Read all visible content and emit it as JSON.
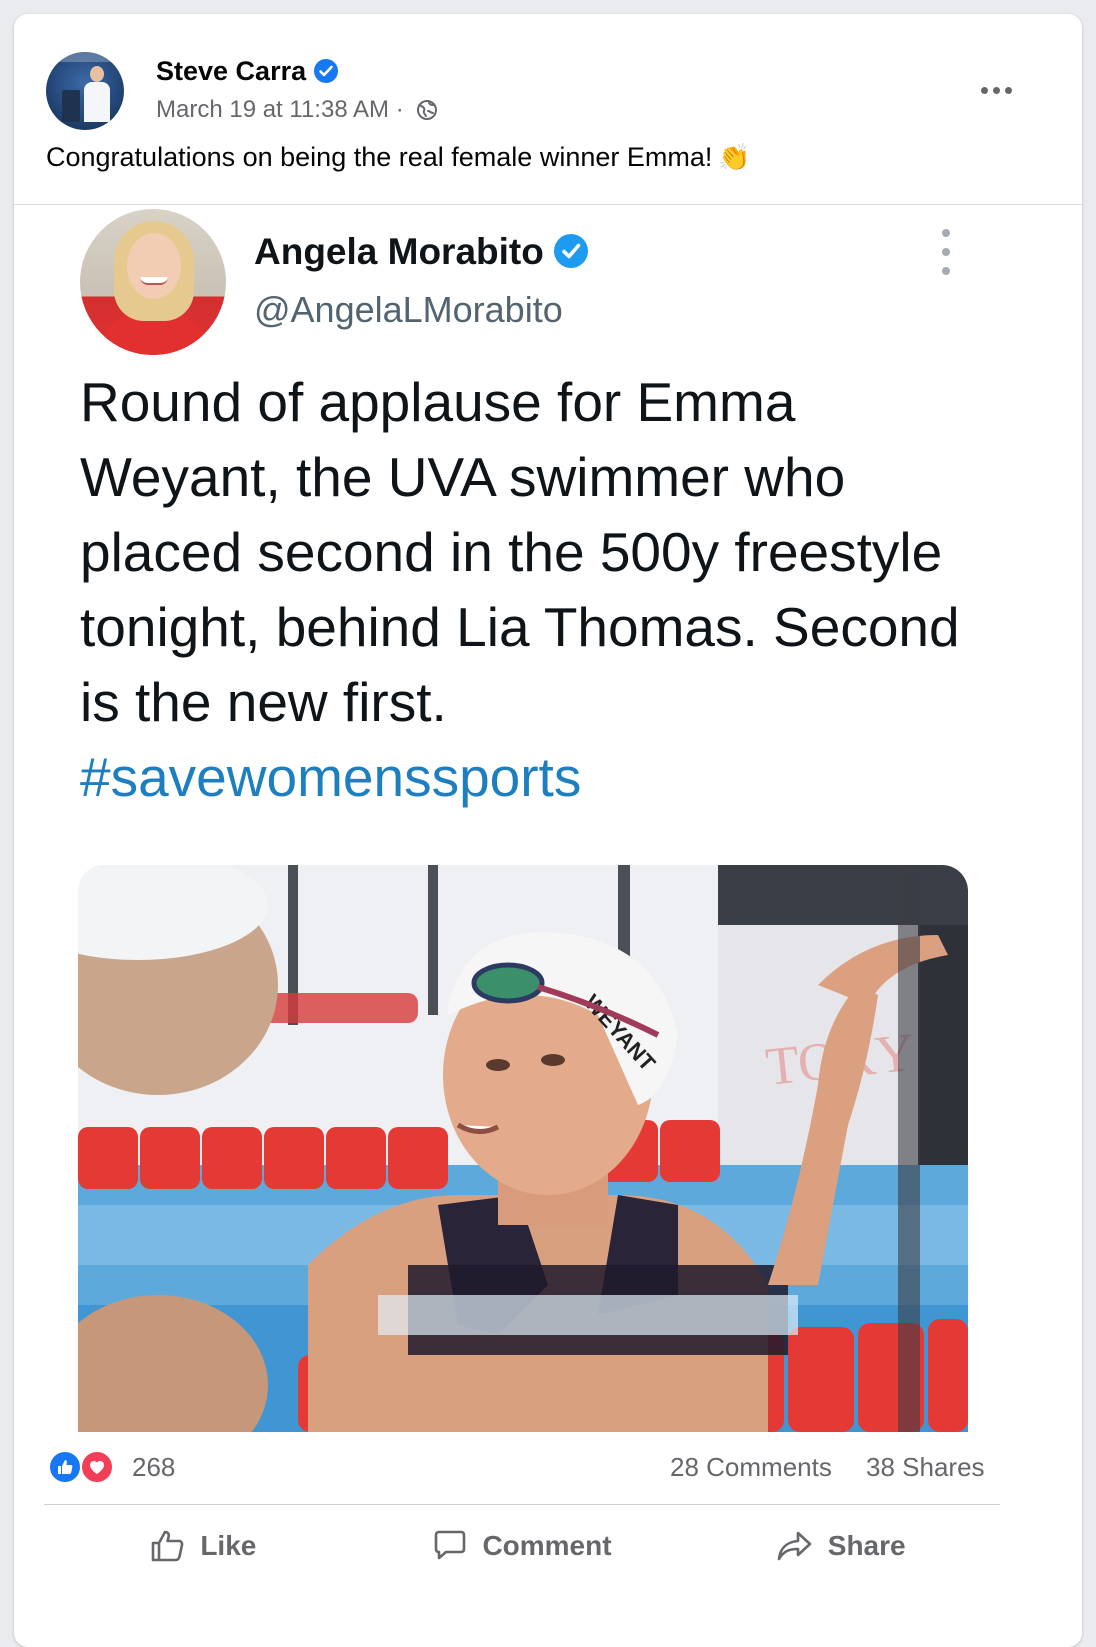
{
  "post": {
    "author": "Steve Carra",
    "timestamp": "March 19 at 11:38 AM",
    "separator": "·",
    "audience_icon": "globe-icon",
    "text": "Congratulations on being the real female winner Emma!",
    "emoji": "👏"
  },
  "tweet": {
    "name": "Angela Morabito",
    "handle": "@AngelaLMorabito",
    "body": "Round of applause for Emma Weyant, the UVA swimmer who placed second in the 500y freestyle tonight, behind Lia Thomas. Second is the new first.",
    "hashtag": "#savewomenssports",
    "photo_cap_text": "WEYANT"
  },
  "stats": {
    "reaction_count": "268",
    "comments": "28 Comments",
    "shares": "38 Shares"
  },
  "actions": {
    "like": "Like",
    "comment": "Comment",
    "share": "Share"
  },
  "colors": {
    "verified_blue": "#1877f2",
    "twitter_blue": "#1d9bf0",
    "hashtag": "#1d7fbf",
    "love_red": "#f33e58",
    "muted_text": "#65676b"
  }
}
